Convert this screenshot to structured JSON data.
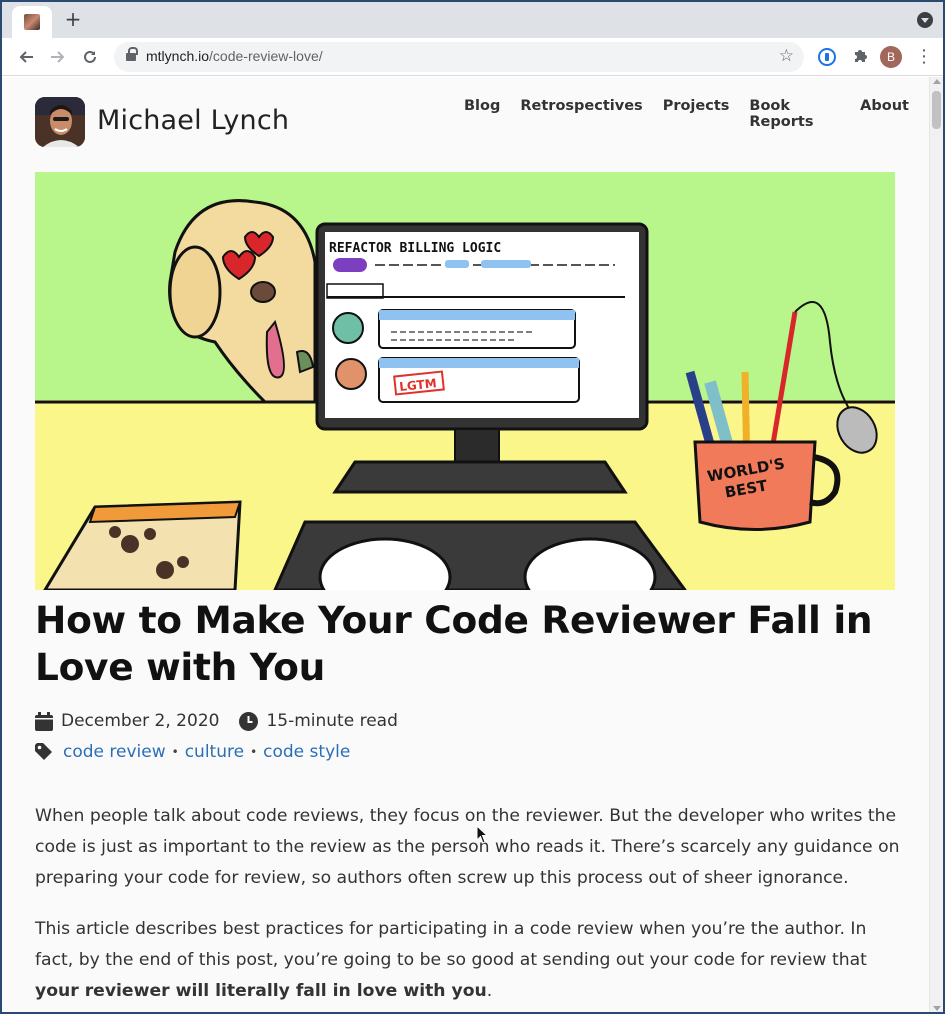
{
  "browser": {
    "url_host": "mtlynch.io",
    "url_path": "/code-review-love/",
    "profile_initial": "B",
    "new_tab_symbol": "+"
  },
  "site": {
    "title": "Michael Lynch",
    "nav": [
      "Blog",
      "Retrospectives",
      "Projects",
      "Book Reports",
      "About"
    ]
  },
  "hero": {
    "screen_title": "REFACTOR BILLING LOGIC",
    "lgtm": "LGTM",
    "mug_text_1": "WORLD'S",
    "mug_text_2": "BEST"
  },
  "post": {
    "title": "How to Make Your Code Reviewer Fall in Love with You",
    "date": "December 2, 2020",
    "read_time": "15-minute read",
    "tags": [
      "code review",
      "culture",
      "code style"
    ],
    "p1": "When people talk about code reviews, they focus on the reviewer. But the developer who writes the code is just as important to the review as the person who reads it. There’s scarcely any guidance on preparing your code for review, so authors often screw up this process out of sheer ignorance.",
    "p2_start": "This article describes best practices for participating in a code review when you’re the author. In fact, by the end of this post, you’re going to be so good at sending out your code for review that ",
    "p2_bold": "your reviewer will literally fall in love with you",
    "p2_end": "."
  },
  "colors": {
    "hero_top": "#b8f58a",
    "hero_bottom": "#fbf68a",
    "link": "#2a6fb6"
  }
}
